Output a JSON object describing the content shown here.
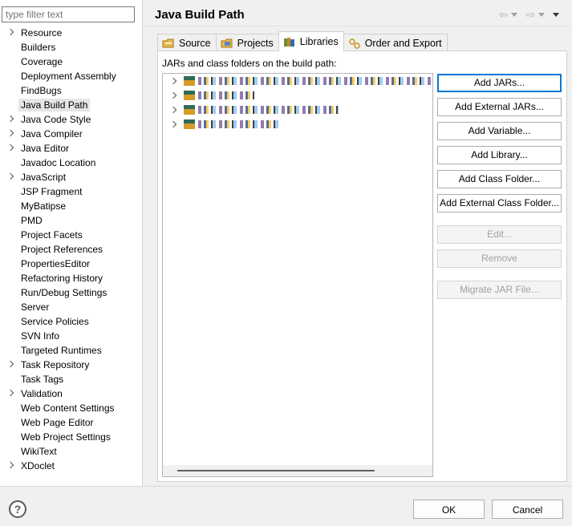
{
  "left_panel": {
    "filter_placeholder": "type filter text",
    "items": [
      {
        "label": "Resource",
        "expandable": true
      },
      {
        "label": "Builders",
        "expandable": false
      },
      {
        "label": "Coverage",
        "expandable": false
      },
      {
        "label": "Deployment Assembly",
        "expandable": false
      },
      {
        "label": "FindBugs",
        "expandable": false
      },
      {
        "label": "Java Build Path",
        "expandable": false,
        "selected": true
      },
      {
        "label": "Java Code Style",
        "expandable": true
      },
      {
        "label": "Java Compiler",
        "expandable": true
      },
      {
        "label": "Java Editor",
        "expandable": true
      },
      {
        "label": "Javadoc Location",
        "expandable": false
      },
      {
        "label": "JavaScript",
        "expandable": true
      },
      {
        "label": "JSP Fragment",
        "expandable": false
      },
      {
        "label": "MyBatipse",
        "expandable": false
      },
      {
        "label": "PMD",
        "expandable": false
      },
      {
        "label": "Project Facets",
        "expandable": false
      },
      {
        "label": "Project References",
        "expandable": false
      },
      {
        "label": "PropertiesEditor",
        "expandable": false
      },
      {
        "label": "Refactoring History",
        "expandable": false
      },
      {
        "label": "Run/Debug Settings",
        "expandable": false
      },
      {
        "label": "Server",
        "expandable": false
      },
      {
        "label": "Service Policies",
        "expandable": false
      },
      {
        "label": "SVN Info",
        "expandable": false
      },
      {
        "label": "Targeted Runtimes",
        "expandable": false
      },
      {
        "label": "Task Repository",
        "expandable": true
      },
      {
        "label": "Task Tags",
        "expandable": false
      },
      {
        "label": "Validation",
        "expandable": true
      },
      {
        "label": "Web Content Settings",
        "expandable": false
      },
      {
        "label": "Web Page Editor",
        "expandable": false
      },
      {
        "label": "Web Project Settings",
        "expandable": false
      },
      {
        "label": "WikiText",
        "expandable": false
      },
      {
        "label": "XDoclet",
        "expandable": true
      }
    ]
  },
  "header": {
    "title": "Java Build Path",
    "icons": [
      "back-arrow-icon",
      "forward-arrow-icon",
      "view-menu-icon"
    ]
  },
  "tabs": [
    {
      "label": "Source",
      "icon": "source-folder-icon"
    },
    {
      "label": "Projects",
      "icon": "projects-icon"
    },
    {
      "label": "Libraries",
      "icon": "libraries-icon",
      "active": true
    },
    {
      "label": "Order and Export",
      "icon": "order-export-icon"
    }
  ],
  "libraries": {
    "section_label": "JARs and class folders on the build path:",
    "entries_count": 4,
    "entries_redacted": true
  },
  "buttons": {
    "add_jars": "Add JARs...",
    "add_external_jars": "Add External JARs...",
    "add_variable": "Add Variable...",
    "add_library": "Add Library...",
    "add_class_folder": "Add Class Folder...",
    "add_external_class_folder": "Add External Class Folder...",
    "edit": "Edit...",
    "remove": "Remove",
    "migrate_jar": "Migrate JAR File..."
  },
  "footer": {
    "help_label": "?",
    "ok_label": "OK",
    "cancel_label": "Cancel"
  },
  "colors": {
    "focus_border": "#0078d7",
    "disabled_text": "#a0a0a0"
  }
}
